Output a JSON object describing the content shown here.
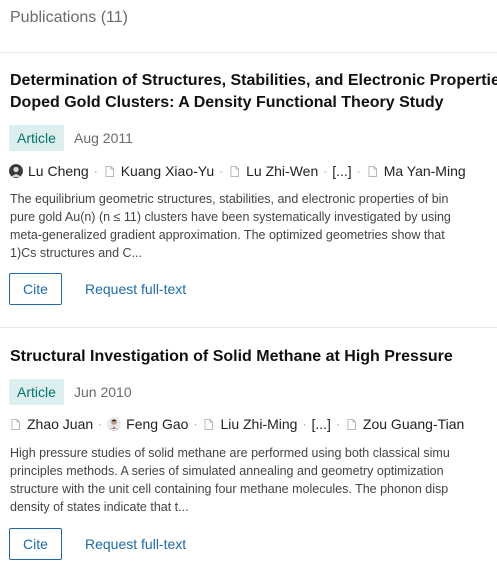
{
  "header": {
    "title": "Publications (11)"
  },
  "publications": [
    {
      "title_line1": "Determination of Structures, Stabilities, and Electronic Propertie",
      "title_line2": "Doped Gold Clusters: A Density Functional Theory Study",
      "type": "Article",
      "date": "Aug 2011",
      "authors": [
        {
          "name": "Lu Cheng",
          "icon": "avatar-photo-icon"
        },
        {
          "name": "Kuang Xiao-Yu",
          "icon": "document-icon"
        },
        {
          "name": "Lu Zhi-Wen",
          "icon": "document-icon"
        },
        {
          "name": "[...]",
          "icon": "none"
        },
        {
          "name": "Ma Yan-Ming",
          "icon": "document-icon"
        }
      ],
      "abstract": [
        "The equilibrium geometric structures, stabilities, and electronic properties of bin",
        "pure gold Au(n) (n ≤ 11) clusters have been systematically investigated by using",
        "meta-generalized gradient approximation. The optimized geometries show that",
        "1)Cs structures and C..."
      ],
      "cite_label": "Cite",
      "request_label": "Request full-text"
    },
    {
      "title_line1": "Structural Investigation of Solid Methane at High Pressure",
      "type": "Article",
      "date": "Jun 2010",
      "authors": [
        {
          "name": "Zhao Juan",
          "icon": "document-icon"
        },
        {
          "name": "Feng Gao",
          "icon": "avatar-photo-icon"
        },
        {
          "name": "Liu Zhi-Ming",
          "icon": "document-icon"
        },
        {
          "name": "[...]",
          "icon": "none"
        },
        {
          "name": "Zou Guang-Tian",
          "icon": "document-icon"
        }
      ],
      "abstract": [
        "High pressure studies of solid methane are performed using both classical simu",
        "principles methods. A series of simulated annealing and geometry optimization",
        "structure with the unit cell containing four methane molecules. The phonon disp",
        "density of states indicate that t..."
      ],
      "cite_label": "Cite",
      "request_label": "Request full-text"
    }
  ],
  "colors": {
    "link": "#1c6bb0",
    "badge_bg": "#dceeed",
    "badge_text": "#00766c",
    "divider": "#e6e6e6"
  }
}
